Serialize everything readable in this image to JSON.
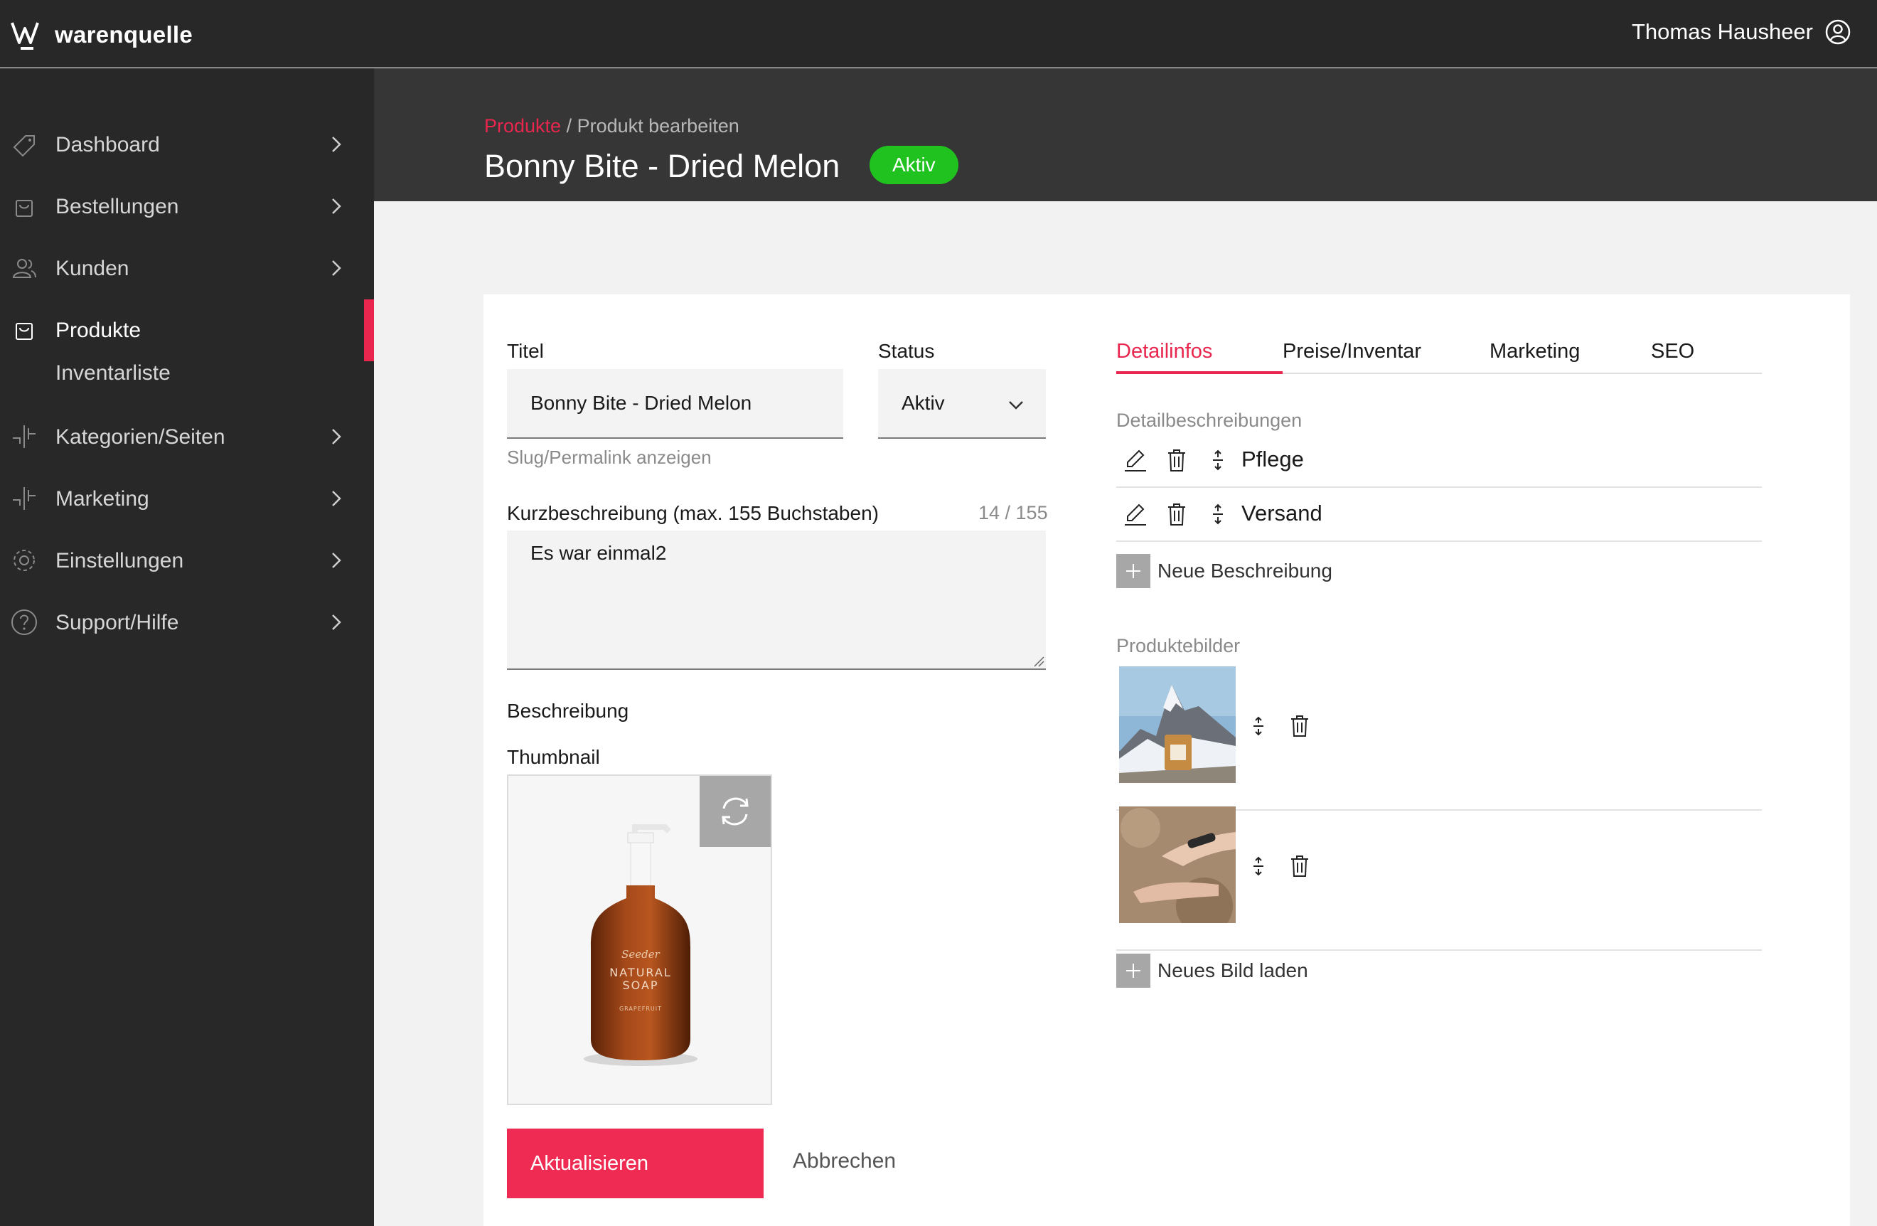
{
  "app": {
    "brand": "warenquelle",
    "user_name": "Thomas Hausheer"
  },
  "sidebar": {
    "items": [
      {
        "label": "Dashboard",
        "icon": "tag-icon"
      },
      {
        "label": "Bestellungen",
        "icon": "shopping-bag-icon"
      },
      {
        "label": "Kunden",
        "icon": "users-icon"
      },
      {
        "label": "Produkte",
        "icon": "product-bag-icon",
        "active": true
      },
      {
        "label": "Inventarliste"
      },
      {
        "label": "Kategorien/Seiten",
        "icon": "sitemap-icon"
      },
      {
        "label": "Marketing",
        "icon": "sitemap-icon"
      },
      {
        "label": "Einstellungen",
        "icon": "gear-icon"
      },
      {
        "label": "Support/Hilfe",
        "icon": "help-circle-icon"
      }
    ]
  },
  "header": {
    "breadcrumb_link": "Produkte",
    "breadcrumb_rest": " / Produkt bearbeiten",
    "title": "Bonny Bite - Dried Melon",
    "status_badge": "Aktiv"
  },
  "form": {
    "title_label": "Titel",
    "title_value": "Bonny Bite - Dried Melon",
    "status_label": "Status",
    "status_value": "Aktiv",
    "slug_link": "Slug/Permalink anzeigen",
    "short_desc_label": "Kurzbeschreibung (max. 155 Buchstaben)",
    "short_desc_count": "14 / 155",
    "short_desc_value": "Es war einmal2",
    "description_label": "Beschreibung",
    "thumbnail_label": "Thumbnail",
    "thumbnail_product": {
      "brand": "Seeder",
      "line1": "NATURAL",
      "line2": "SOAP",
      "variant": "GRAPEFRUIT"
    },
    "submit_label": "Aktualisieren",
    "cancel_label": "Abbrechen"
  },
  "tabs": [
    {
      "label": "Detailinfos",
      "active": true
    },
    {
      "label": "Preise/Inventar"
    },
    {
      "label": "Marketing"
    },
    {
      "label": "SEO"
    }
  ],
  "details": {
    "section_label": "Detailbeschreibungen",
    "rows": [
      {
        "label": "Pflege"
      },
      {
        "label": "Versand"
      }
    ],
    "add_label": "Neue Beschreibung"
  },
  "images": {
    "section_label": "Produktebilder",
    "items": [
      {
        "subject": "mountain-product-photo"
      },
      {
        "subject": "hands-serum-photo"
      }
    ],
    "add_label": "Neues Bild laden"
  },
  "colors": {
    "accent": "#e8264e",
    "active_badge": "#1fc21f",
    "dark_bg": "#282828",
    "header_bg": "#363636"
  }
}
